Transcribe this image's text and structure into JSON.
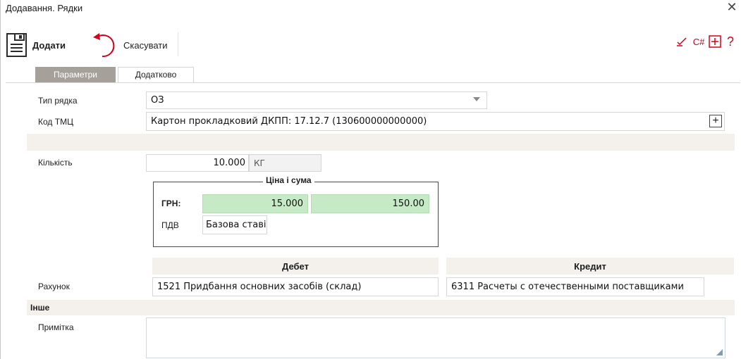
{
  "window": {
    "title": "Додавання. Рядки"
  },
  "toolbar": {
    "add_label": "Додати",
    "cancel_label": "Скасувати",
    "right_icons": [
      "edit-check-icon",
      "csharp-icon",
      "plus-box-icon",
      "help-icon"
    ],
    "csharp_label": "C#",
    "help_label": "?"
  },
  "tabs": [
    {
      "label": "Параметри",
      "active": true
    },
    {
      "label": "Додатково",
      "active": false
    }
  ],
  "form": {
    "type_label": "Тип рядка",
    "type_value": "ОЗ",
    "code_label": "Код ТМЦ",
    "code_value": "Картон прокладковий ДКПП: 17.12.7 (130600000000000)",
    "qty_label": "Кількість",
    "qty_value": "10.000",
    "qty_unit": "КГ",
    "price_group": {
      "title": "Ціна і сума",
      "currency_label": "ГРН:",
      "price": "15.000",
      "sum": "150.00",
      "vat_label": "ПДВ",
      "vat_value": "Базова ставі"
    },
    "account_label": "Рахунок",
    "debit_header": "Дебет",
    "credit_header": "Кредит",
    "debit_value": "1521 Придбання основних засобів (склад)",
    "credit_value": "6311 Расчеты с отечественными поставщиками",
    "other_section": "Інше",
    "note_label": "Примітка",
    "note_value": ""
  },
  "colors": {
    "accent_red": "#d0021b",
    "active_tab": "#a6a09a",
    "green_field": "#c6e9c6",
    "section_band": "#f4f1ec"
  }
}
